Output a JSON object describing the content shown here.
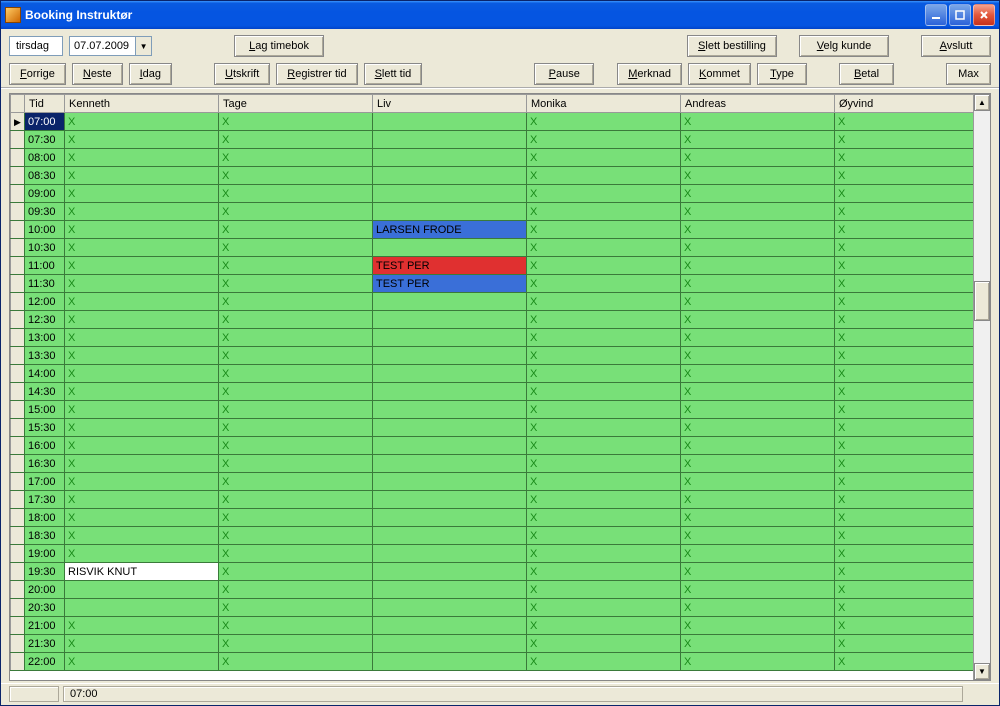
{
  "title": "Booking Instruktør",
  "win": {
    "min": "_",
    "max": "□",
    "close": "X"
  },
  "toolbar": {
    "day": "tirsdag",
    "date": "07.07.2009",
    "lag_timebok": "Lag timebok",
    "slett_bestilling": "Slett bestilling",
    "velg_kunde": "Velg kunde",
    "avslutt": "Avslutt",
    "forrige": "Forrige",
    "neste": "Neste",
    "idag": "Idag",
    "utskrift": "Utskrift",
    "registrer_tid": "Registrer tid",
    "slett_tid": "Slett tid",
    "pause": "Pause",
    "merknad": "Merknad",
    "kommet": "Kommet",
    "type": "Type",
    "betal": "Betal",
    "max": "Max"
  },
  "columns": [
    "Tid",
    "Kenneth",
    "Tage",
    "Liv",
    "Monika",
    "Andreas",
    "Øyvind"
  ],
  "times": [
    "07:00",
    "07:30",
    "08:00",
    "08:30",
    "09:00",
    "09:30",
    "10:00",
    "10:30",
    "11:00",
    "11:30",
    "12:00",
    "12:30",
    "13:00",
    "13:30",
    "14:00",
    "14:30",
    "15:00",
    "15:30",
    "16:00",
    "16:30",
    "17:00",
    "17:30",
    "18:00",
    "18:30",
    "19:00",
    "19:30",
    "20:00",
    "20:30",
    "21:00",
    "21:30",
    "22:00"
  ],
  "selected_row_index": 0,
  "rows": [
    {
      "cells": [
        {
          "t": "x"
        },
        {
          "t": "x"
        },
        {
          "t": "e"
        },
        {
          "t": "x"
        },
        {
          "t": "x"
        },
        {
          "t": "x"
        }
      ]
    },
    {
      "cells": [
        {
          "t": "x"
        },
        {
          "t": "x"
        },
        {
          "t": "e"
        },
        {
          "t": "x"
        },
        {
          "t": "x"
        },
        {
          "t": "x"
        }
      ]
    },
    {
      "cells": [
        {
          "t": "x"
        },
        {
          "t": "x"
        },
        {
          "t": "e"
        },
        {
          "t": "x"
        },
        {
          "t": "x"
        },
        {
          "t": "x"
        }
      ]
    },
    {
      "cells": [
        {
          "t": "x"
        },
        {
          "t": "x"
        },
        {
          "t": "e"
        },
        {
          "t": "x"
        },
        {
          "t": "x"
        },
        {
          "t": "x"
        }
      ]
    },
    {
      "cells": [
        {
          "t": "x"
        },
        {
          "t": "x"
        },
        {
          "t": "e"
        },
        {
          "t": "x"
        },
        {
          "t": "x"
        },
        {
          "t": "x"
        }
      ]
    },
    {
      "cells": [
        {
          "t": "x"
        },
        {
          "t": "x"
        },
        {
          "t": "e"
        },
        {
          "t": "x"
        },
        {
          "t": "x"
        },
        {
          "t": "x"
        }
      ]
    },
    {
      "cells": [
        {
          "t": "x"
        },
        {
          "t": "x"
        },
        {
          "t": "blue",
          "text": "LARSEN FRODE"
        },
        {
          "t": "x"
        },
        {
          "t": "x"
        },
        {
          "t": "x"
        }
      ]
    },
    {
      "cells": [
        {
          "t": "x"
        },
        {
          "t": "x"
        },
        {
          "t": "e"
        },
        {
          "t": "x"
        },
        {
          "t": "x"
        },
        {
          "t": "x"
        }
      ]
    },
    {
      "cells": [
        {
          "t": "x"
        },
        {
          "t": "x"
        },
        {
          "t": "red",
          "text": "TEST PER"
        },
        {
          "t": "x"
        },
        {
          "t": "x"
        },
        {
          "t": "x"
        }
      ]
    },
    {
      "cells": [
        {
          "t": "x"
        },
        {
          "t": "x"
        },
        {
          "t": "blue",
          "text": "TEST PER"
        },
        {
          "t": "x"
        },
        {
          "t": "x"
        },
        {
          "t": "x"
        }
      ]
    },
    {
      "cells": [
        {
          "t": "x"
        },
        {
          "t": "x"
        },
        {
          "t": "e"
        },
        {
          "t": "x"
        },
        {
          "t": "x"
        },
        {
          "t": "x"
        }
      ]
    },
    {
      "cells": [
        {
          "t": "x"
        },
        {
          "t": "x"
        },
        {
          "t": "e"
        },
        {
          "t": "x"
        },
        {
          "t": "x"
        },
        {
          "t": "x"
        }
      ]
    },
    {
      "cells": [
        {
          "t": "x"
        },
        {
          "t": "x"
        },
        {
          "t": "e"
        },
        {
          "t": "x"
        },
        {
          "t": "x"
        },
        {
          "t": "x"
        }
      ]
    },
    {
      "cells": [
        {
          "t": "x"
        },
        {
          "t": "x"
        },
        {
          "t": "e"
        },
        {
          "t": "x"
        },
        {
          "t": "x"
        },
        {
          "t": "x"
        }
      ]
    },
    {
      "cells": [
        {
          "t": "x"
        },
        {
          "t": "x"
        },
        {
          "t": "e"
        },
        {
          "t": "x"
        },
        {
          "t": "x"
        },
        {
          "t": "x"
        }
      ]
    },
    {
      "cells": [
        {
          "t": "x"
        },
        {
          "t": "x"
        },
        {
          "t": "e"
        },
        {
          "t": "x"
        },
        {
          "t": "x"
        },
        {
          "t": "x"
        }
      ]
    },
    {
      "cells": [
        {
          "t": "x"
        },
        {
          "t": "x"
        },
        {
          "t": "e"
        },
        {
          "t": "x"
        },
        {
          "t": "x"
        },
        {
          "t": "x"
        }
      ]
    },
    {
      "cells": [
        {
          "t": "x"
        },
        {
          "t": "x"
        },
        {
          "t": "e"
        },
        {
          "t": "x"
        },
        {
          "t": "x"
        },
        {
          "t": "x"
        }
      ]
    },
    {
      "cells": [
        {
          "t": "x"
        },
        {
          "t": "x"
        },
        {
          "t": "e"
        },
        {
          "t": "x"
        },
        {
          "t": "x"
        },
        {
          "t": "x"
        }
      ]
    },
    {
      "cells": [
        {
          "t": "x"
        },
        {
          "t": "x"
        },
        {
          "t": "e"
        },
        {
          "t": "x"
        },
        {
          "t": "x"
        },
        {
          "t": "x"
        }
      ]
    },
    {
      "cells": [
        {
          "t": "x"
        },
        {
          "t": "x"
        },
        {
          "t": "e"
        },
        {
          "t": "x"
        },
        {
          "t": "x"
        },
        {
          "t": "x"
        }
      ]
    },
    {
      "cells": [
        {
          "t": "x"
        },
        {
          "t": "x"
        },
        {
          "t": "e"
        },
        {
          "t": "x"
        },
        {
          "t": "x"
        },
        {
          "t": "x"
        }
      ]
    },
    {
      "cells": [
        {
          "t": "x"
        },
        {
          "t": "x"
        },
        {
          "t": "e"
        },
        {
          "t": "x"
        },
        {
          "t": "x"
        },
        {
          "t": "x"
        }
      ]
    },
    {
      "cells": [
        {
          "t": "x"
        },
        {
          "t": "x"
        },
        {
          "t": "e"
        },
        {
          "t": "x"
        },
        {
          "t": "x"
        },
        {
          "t": "x"
        }
      ]
    },
    {
      "cells": [
        {
          "t": "x"
        },
        {
          "t": "x"
        },
        {
          "t": "e"
        },
        {
          "t": "x"
        },
        {
          "t": "x"
        },
        {
          "t": "x"
        }
      ]
    },
    {
      "cells": [
        {
          "t": "white",
          "text": "RISVIK KNUT"
        },
        {
          "t": "x"
        },
        {
          "t": "e"
        },
        {
          "t": "x"
        },
        {
          "t": "x"
        },
        {
          "t": "x"
        }
      ]
    },
    {
      "cells": [
        {
          "t": "e"
        },
        {
          "t": "x"
        },
        {
          "t": "e"
        },
        {
          "t": "x"
        },
        {
          "t": "x"
        },
        {
          "t": "x"
        }
      ]
    },
    {
      "cells": [
        {
          "t": "e"
        },
        {
          "t": "x"
        },
        {
          "t": "e"
        },
        {
          "t": "x"
        },
        {
          "t": "x"
        },
        {
          "t": "x"
        }
      ]
    },
    {
      "cells": [
        {
          "t": "x"
        },
        {
          "t": "x"
        },
        {
          "t": "e"
        },
        {
          "t": "x"
        },
        {
          "t": "x"
        },
        {
          "t": "x"
        }
      ]
    },
    {
      "cells": [
        {
          "t": "x"
        },
        {
          "t": "x"
        },
        {
          "t": "e"
        },
        {
          "t": "x"
        },
        {
          "t": "x"
        },
        {
          "t": "x"
        }
      ]
    },
    {
      "cells": [
        {
          "t": "x"
        },
        {
          "t": "x"
        },
        {
          "t": "e"
        },
        {
          "t": "x"
        },
        {
          "t": "x"
        },
        {
          "t": "x"
        }
      ]
    }
  ],
  "status": {
    "time": "07:00"
  }
}
